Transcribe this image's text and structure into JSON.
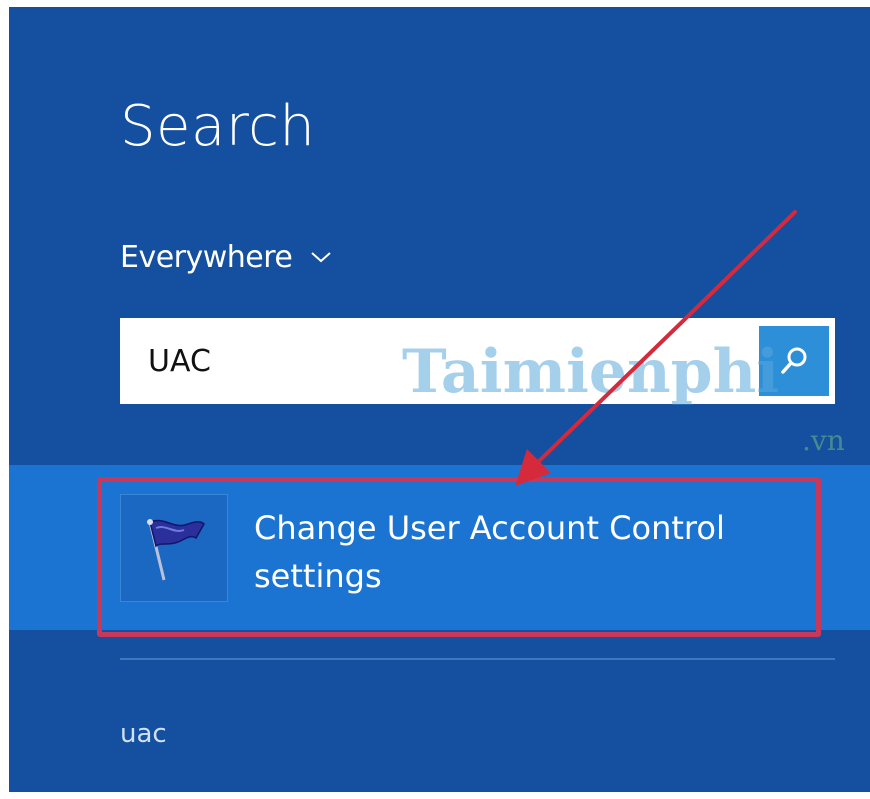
{
  "search_pane": {
    "title": "Search",
    "scope": {
      "selected": "Everywhere"
    },
    "query": "UAC",
    "results": [
      {
        "label": "Change User Account Control settings",
        "icon": "uac-flag-icon"
      }
    ],
    "suggestions": [
      "uac"
    ]
  },
  "watermark": {
    "text": "Taimienphi",
    "subtext": ".vn"
  },
  "colors": {
    "pane_background": "#144fa0",
    "result_highlight": "#1c74d2",
    "search_button": "#2c8fd8",
    "annotation": "#d42a3c"
  }
}
